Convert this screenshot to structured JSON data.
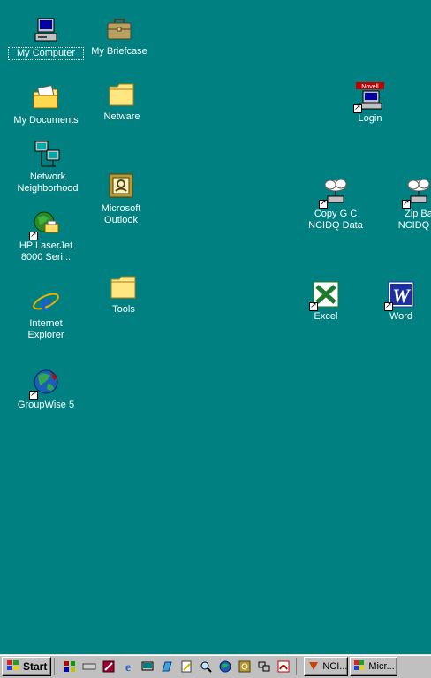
{
  "desktop": {
    "icons": {
      "my_computer": "My Computer",
      "my_briefcase": "My Briefcase",
      "my_documents": "My Documents",
      "netware": "Netware",
      "network_neighborhood": "Network\nNeighborhood",
      "hp_laserjet": "HP LaserJet\n8000 Seri...",
      "microsoft_outlook": "Microsoft\nOutlook",
      "internet_explorer": "Internet\nExplorer",
      "tools": "Tools",
      "groupwise": "GroupWise 5",
      "login": "Login",
      "login_badge": "Novell",
      "copy_ncidq": "Copy G C\nNCIDQ Data",
      "zip_ncidq": "Zip Ba\nNCIDQ D",
      "excel": "Excel",
      "word": "Word"
    }
  },
  "taskbar": {
    "start_label": "Start",
    "tasks": {
      "task1": "NCI...",
      "task2": "Micr..."
    }
  },
  "colors": {
    "desktop": "#008080",
    "taskbar": "#c0c0c0",
    "folder": "#ffe680",
    "ie_blue": "#1e5bd6",
    "excel_green": "#1d7a2c",
    "word_blue": "#1b2fa0"
  }
}
